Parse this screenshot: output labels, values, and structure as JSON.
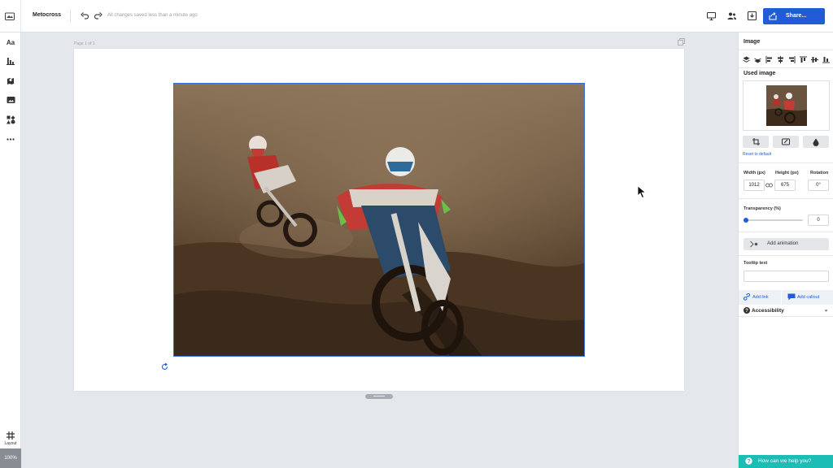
{
  "topbar": {
    "doc_title": "Metocross",
    "save_status": "All changes saved less than a minute ago",
    "share_label": "Share..."
  },
  "leftrail": {
    "text_icon_label": "Aa",
    "layout_label": "Layout",
    "zoom": "100%"
  },
  "canvas": {
    "page_label": "Page 1 of 1"
  },
  "panel": {
    "title": "Image",
    "used_image_label": "Used image",
    "reset_label": "Reset to default",
    "width_label": "Width (px)",
    "height_label": "Height (px)",
    "rotation_label": "Rotation",
    "width_value": "1012",
    "height_value": "675",
    "rotation_value": "0°",
    "transparency_label": "Transparency (%)",
    "transparency_value": "0",
    "transparency_fraction": 0,
    "add_animation_label": "Add animation",
    "tooltip_label": "Tooltip text",
    "tooltip_value": "",
    "add_link_label": "Add link",
    "add_callout_label": "Add callout",
    "accessibility_label": "Accessibility",
    "help_label": "How can we help you?"
  },
  "colors": {
    "accent": "#1f5cd6",
    "help": "#1cbdb5",
    "canvas_bg": "#e4e7eb"
  }
}
